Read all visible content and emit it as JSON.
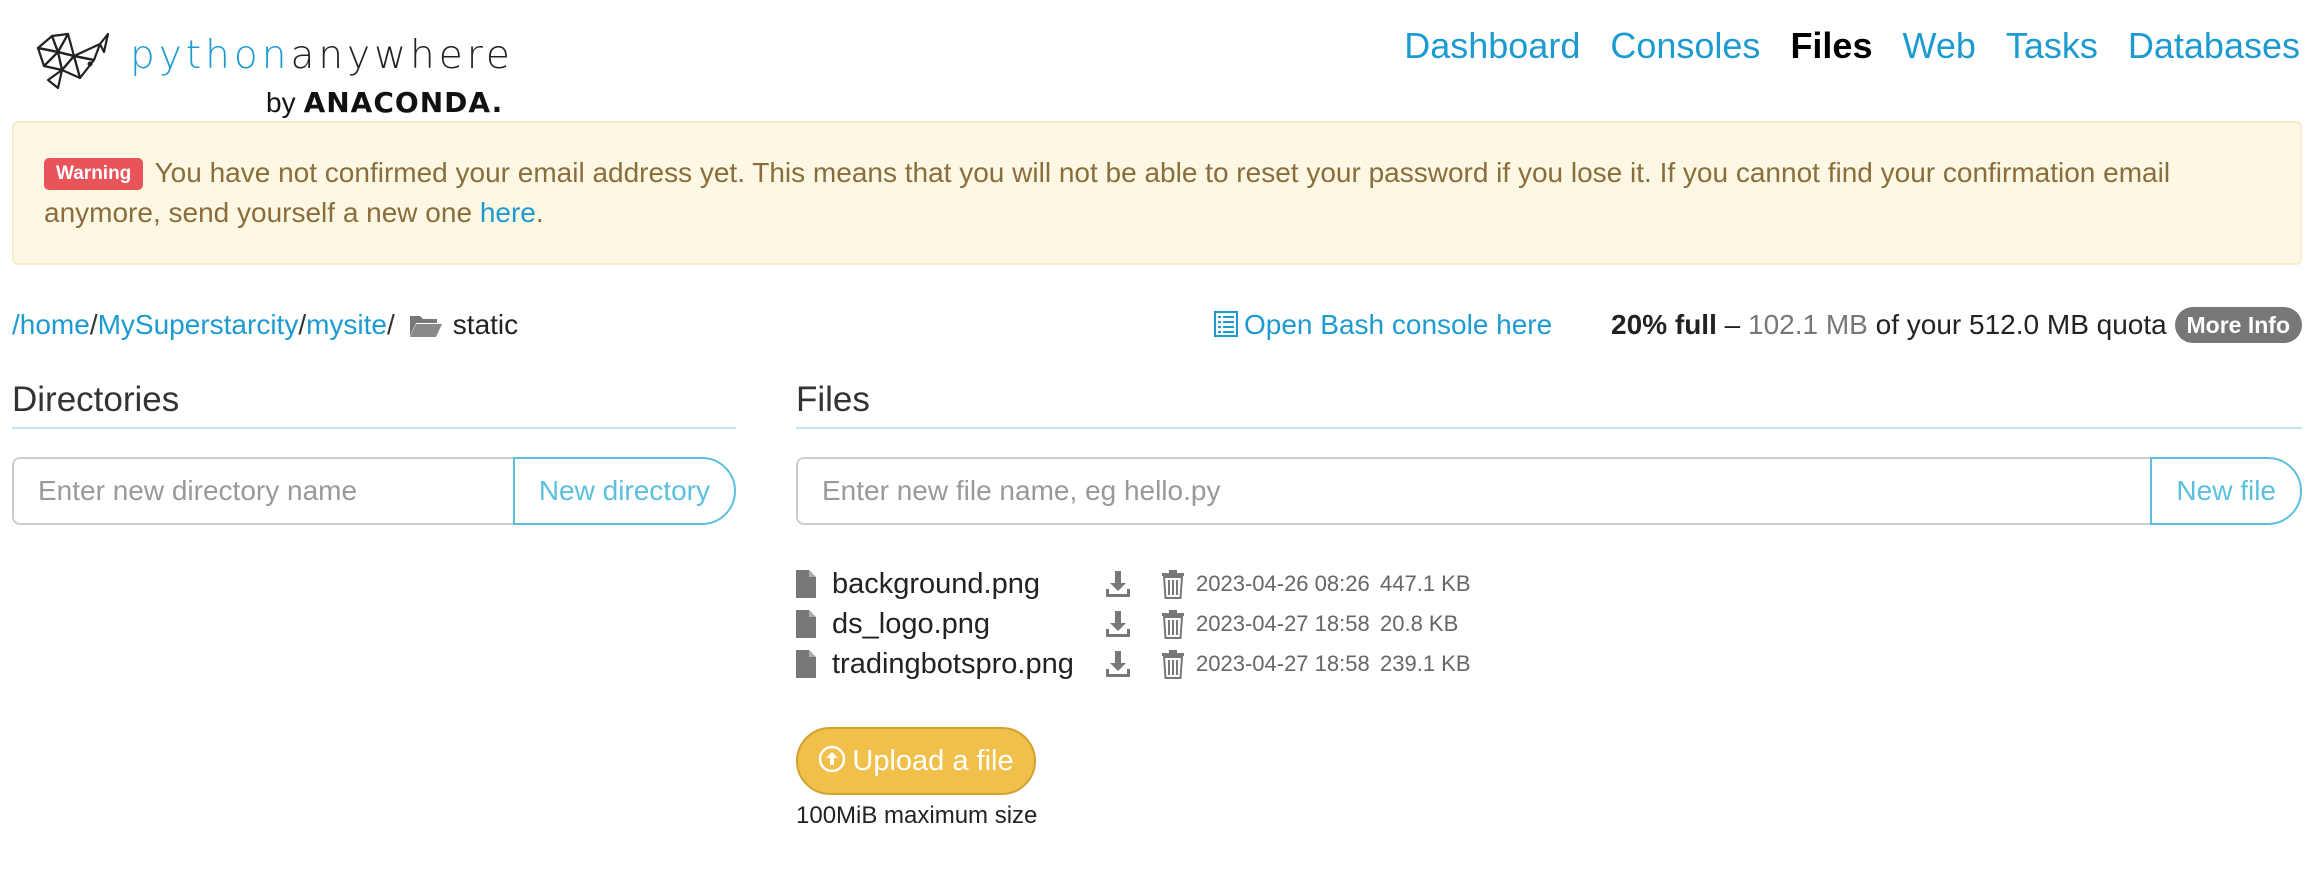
{
  "logo": {
    "word_python": "python",
    "word_anywhere": "anywhere",
    "by": "by",
    "brand": "ANACONDA."
  },
  "nav": {
    "items": [
      "Dashboard",
      "Consoles",
      "Files",
      "Web",
      "Tasks",
      "Databases"
    ],
    "active": "Files"
  },
  "alert": {
    "badge": "Warning",
    "message": "You have not confirmed your email address yet. This means that you will not be able to reset your password if you lose it. If you cannot find your confirmation email anymore, send yourself a new one ",
    "link": "here",
    "tail": "."
  },
  "breadcrumb": {
    "home": "/home",
    "sep1": "/",
    "user": "MySuperstarcity",
    "sep2": "/",
    "site": "mysite",
    "sep3": "/",
    "current": "static"
  },
  "bash_link": "Open Bash console here",
  "quota": {
    "percent": "20% full",
    "dash": " – ",
    "used": "102.1 MB",
    "of_text": " of your 512.0 MB quota ",
    "more_info": "More Info"
  },
  "directories": {
    "title": "Directories",
    "placeholder": "Enter new directory name",
    "button": "New directory"
  },
  "files": {
    "title": "Files",
    "placeholder": "Enter new file name, eg hello.py",
    "button": "New file",
    "items": [
      {
        "name": "background.png",
        "date": "2023-04-26 08:26",
        "size": "447.1 KB"
      },
      {
        "name": "ds_logo.png",
        "date": "2023-04-27 18:58",
        "size": "20.8 KB"
      },
      {
        "name": "tradingbotspro.png",
        "date": "2023-04-27 18:58",
        "size": "239.1 KB"
      }
    ]
  },
  "upload": {
    "button": "Upload a file",
    "note": "100MiB maximum size"
  },
  "colors": {
    "link": "#1d9bd1",
    "warning_bg": "#fcf8e3",
    "warning_text": "#8a6d3b",
    "badge": "#e9535a",
    "upload": "#f0c04a",
    "info_button": "#5bc0de"
  }
}
